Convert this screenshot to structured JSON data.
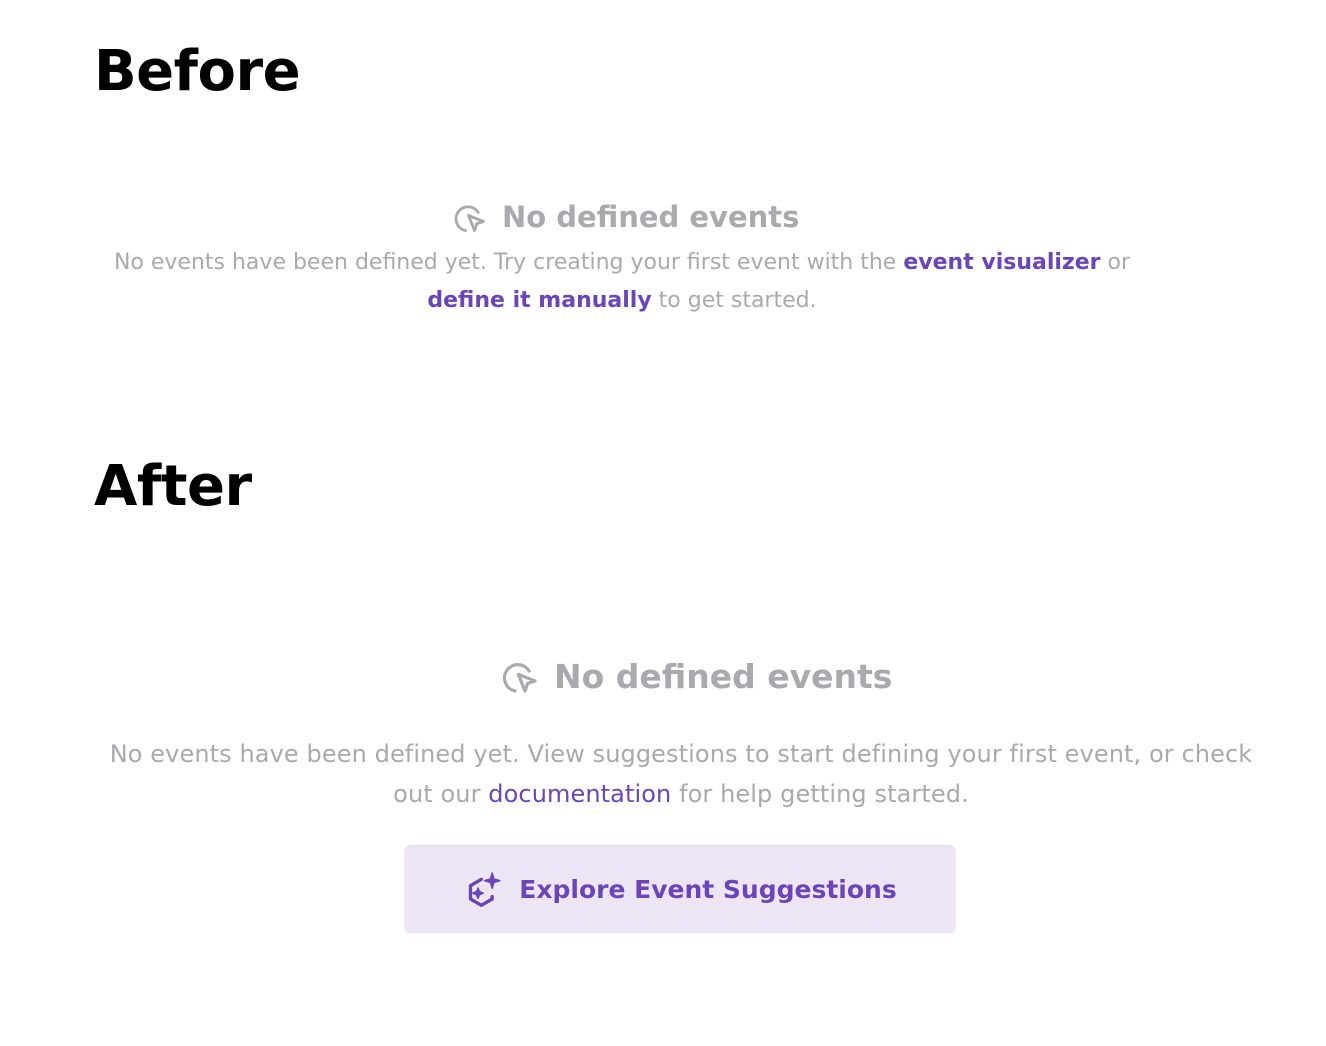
{
  "before": {
    "heading": "Before",
    "title": "No defined events",
    "description": {
      "part1": "No events have been defined yet. Try creating your first event with the ",
      "link1": "event visualizer",
      "part2": " or",
      "link2": "define it manually",
      "part3": " to get started."
    },
    "icon": "cursor-click-icon"
  },
  "after": {
    "heading": "After",
    "title": "No defined events",
    "description": {
      "part1": "No events have been defined yet. View suggestions to start defining your first event, or check",
      "part2": "out our ",
      "link": "documentation",
      "part3": " for help getting started."
    },
    "icon": "cursor-click-icon",
    "button": {
      "label": "Explore Event Suggestions",
      "icon": "sparkle-hexagon-icon"
    }
  },
  "colors": {
    "muted_text": "#a9a9ae",
    "link": "#6b45b8",
    "button_bg": "#ede4f4",
    "heading": "#000000"
  }
}
